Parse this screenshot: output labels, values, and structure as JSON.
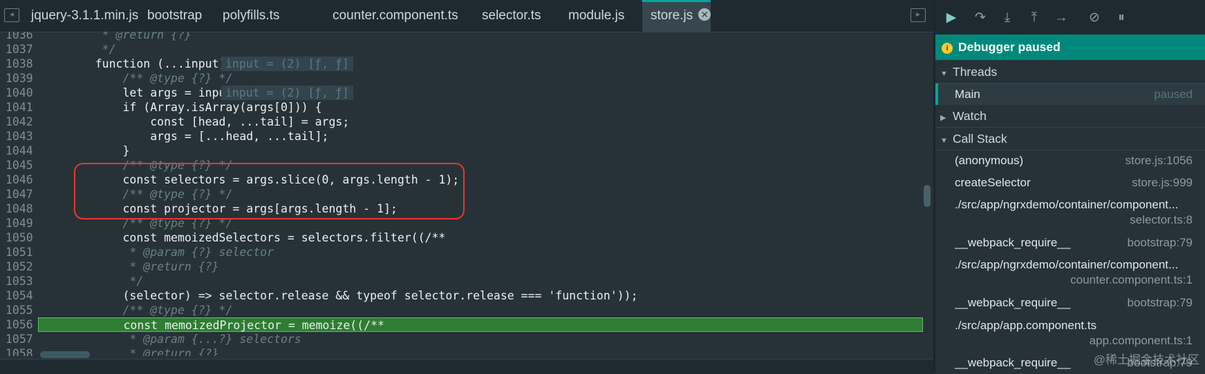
{
  "tabs": [
    "jquery-3.1.1.min.js",
    "bootstrap",
    "polyfills.ts",
    "counter.component.ts",
    "selector.ts",
    "module.js",
    "store.js"
  ],
  "active_tab_close": "✕",
  "lines": [
    {
      "n": "1036",
      "src": "     * @return {?}"
    },
    {
      "n": "1037",
      "src": "     */"
    },
    {
      "n": "1038",
      "src": "    function (...input) {"
    },
    {
      "n": "1039",
      "src": "        /** @type {?} */"
    },
    {
      "n": "1040",
      "src": "        let args = input;"
    },
    {
      "n": "1041",
      "src": "        if (Array.isArray(args[0])) {"
    },
    {
      "n": "1042",
      "src": "            const [head, ...tail] = args;"
    },
    {
      "n": "1043",
      "src": "            args = [...head, ...tail];"
    },
    {
      "n": "1044",
      "src": "        }"
    },
    {
      "n": "1045",
      "src": "        /** @type {?} */"
    },
    {
      "n": "1046",
      "src": "        const selectors = args.slice(0, args.length - 1);"
    },
    {
      "n": "1047",
      "src": "        /** @type {?} */"
    },
    {
      "n": "1048",
      "src": "        const projector = args[args.length - 1];"
    },
    {
      "n": "1049",
      "src": "        /** @type {?} */"
    },
    {
      "n": "1050",
      "src": "        const memoizedSelectors = selectors.filter((/**"
    },
    {
      "n": "1051",
      "src": "         * @param {?} selector"
    },
    {
      "n": "1052",
      "src": "         * @return {?}"
    },
    {
      "n": "1053",
      "src": "         */"
    },
    {
      "n": "1054",
      "src": "        (selector) => selector.release && typeof selector.release === 'function'));"
    },
    {
      "n": "1055",
      "src": "        /** @type {?} */"
    },
    {
      "n": "1056",
      "src": "        const memoizedProjector = memoize((/**"
    },
    {
      "n": "1057",
      "src": "         * @param {...?} selectors"
    },
    {
      "n": "1058",
      "src": "         * @return {?}"
    }
  ],
  "inline_values": {
    "line1038": "input = (2) [ƒ, ƒ]",
    "line1040": "input = (2) [ƒ, ƒ]"
  },
  "debugger": {
    "banner": "Debugger paused",
    "threads_label": "Threads",
    "thread": {
      "name": "Main",
      "status": "paused"
    },
    "watch_label": "Watch",
    "callstack_label": "Call Stack",
    "frames": [
      {
        "name": "(anonymous)",
        "loc": "store.js:1056"
      },
      {
        "name": "createSelector",
        "loc": "store.js:999"
      },
      {
        "name": "./src/app/ngrxdemo/container/component...",
        "loc": "selector.ts:8"
      },
      {
        "name": "__webpack_require__",
        "loc": "bootstrap:79"
      },
      {
        "name": "./src/app/ngrxdemo/container/component...",
        "loc": "counter.component.ts:1"
      },
      {
        "name": "__webpack_require__",
        "loc": "bootstrap:79"
      },
      {
        "name": "./src/app/app.component.ts",
        "loc": "app.component.ts:1"
      },
      {
        "name": "__webpack_require__",
        "loc": "bootstrap:79"
      }
    ]
  },
  "watermark": "@稀土掘金技术社区",
  "colors": {
    "accent": "#00a89d",
    "banner": "#00897b",
    "highlight": "#2e7d32",
    "box": "#e53935"
  }
}
